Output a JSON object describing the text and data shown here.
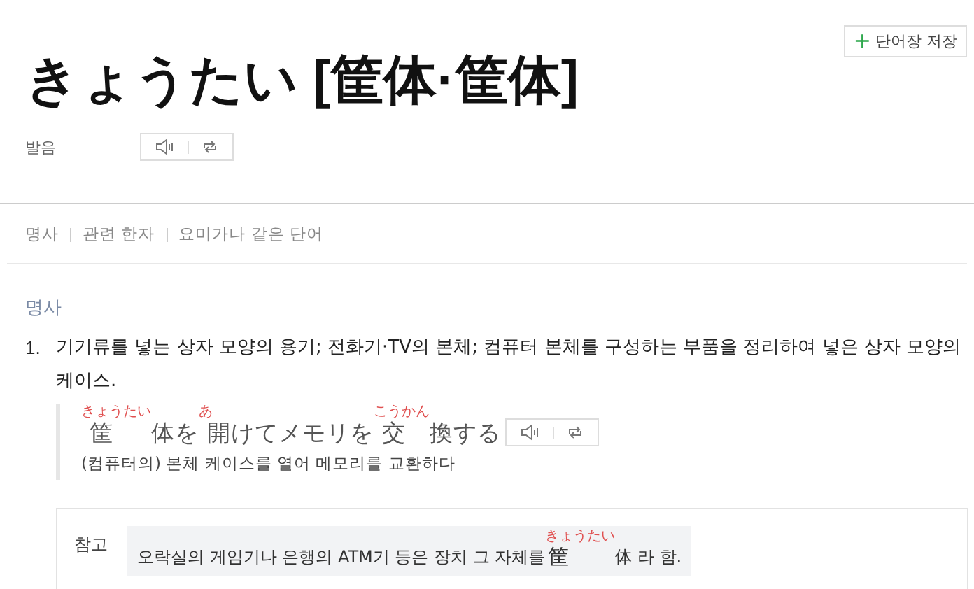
{
  "save_button": {
    "icon": "+",
    "label": "단어장 저장"
  },
  "headword": "きょうたい [筐体·筐体]",
  "pronunciation": {
    "label": "발음"
  },
  "nav": [
    "명사",
    "관련 한자",
    "요미가나 같은 단어"
  ],
  "sense": {
    "pos": "명사",
    "number": "1.",
    "definition": "기기류를 넣는 상자 모양의 용기; 전화기·TV의 본체; 컴퓨터 본체를 구성하는 부품을 정리하여 넣은 상자 모양의 케이스.",
    "example": [
      {
        "text": "筐",
        "ruby": "きょうたい"
      },
      {
        "text": "体を"
      },
      {
        "text": "開",
        "ruby": "あ"
      },
      {
        "text": "けてメモリを"
      },
      {
        "text": "交",
        "ruby": "こうかん"
      },
      {
        "text": "換する"
      }
    ],
    "translation": "(컴퓨터의) 본체 케이스를 열어 메모리를 교환하다"
  },
  "note": {
    "label": "참고",
    "segments": [
      {
        "text": "오락실의 게임기나 은행의 ATM기 등은 장치 그 자체를 "
      },
      {
        "text": "筐",
        "ruby": "きょうたい"
      },
      {
        "text": "体 라 함."
      }
    ]
  }
}
